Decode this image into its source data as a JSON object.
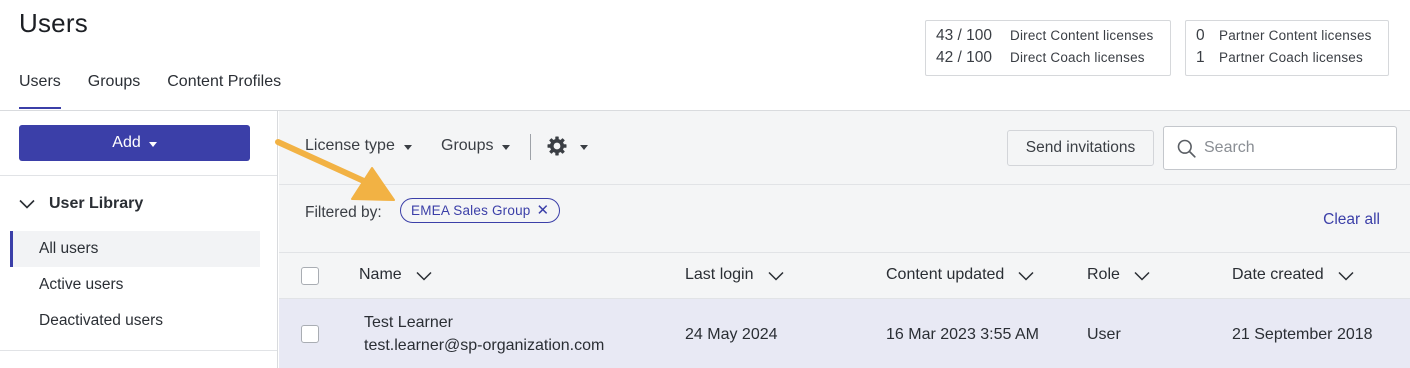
{
  "page": {
    "title": "Users"
  },
  "top_tabs": [
    {
      "label": "Users",
      "active": true
    },
    {
      "label": "Groups",
      "active": false
    },
    {
      "label": "Content Profiles",
      "active": false
    }
  ],
  "licenses": {
    "direct": [
      {
        "count": "43 / 100",
        "label": "Direct Content licenses"
      },
      {
        "count": "42 / 100",
        "label": "Direct Coach licenses"
      }
    ],
    "partner": [
      {
        "count": "0",
        "label": "Partner Content licenses"
      },
      {
        "count": "1",
        "label": "Partner Coach licenses"
      }
    ]
  },
  "sidebar": {
    "add_label": "Add",
    "library_title": "User Library",
    "items": [
      {
        "label": "All users",
        "active": true
      },
      {
        "label": "Active users",
        "active": false
      },
      {
        "label": "Deactivated users",
        "active": false
      }
    ]
  },
  "toolbar": {
    "license_type": "License type",
    "groups": "Groups",
    "settings_icon": "gear-icon",
    "send_invitations": "Send invitations",
    "search_placeholder": "Search"
  },
  "filter": {
    "label": "Filtered by:",
    "chip": "EMEA Sales Group",
    "clear_all": "Clear all"
  },
  "table": {
    "columns": [
      "Name",
      "Last login",
      "Content updated",
      "Role",
      "Date created"
    ],
    "rows": [
      {
        "name": "Test Learner",
        "email": "test.learner@sp-organization.com",
        "last_login": "24 May 2024",
        "content_updated": "16 Mar 2023 3:55 AM",
        "role": "User",
        "date_created": "21 September 2018"
      }
    ]
  },
  "colors": {
    "accent": "#3b3fa8",
    "annotation_arrow": "#f2b244",
    "row_highlight": "#e8e9f4",
    "main_bg": "#f4f5f6"
  }
}
